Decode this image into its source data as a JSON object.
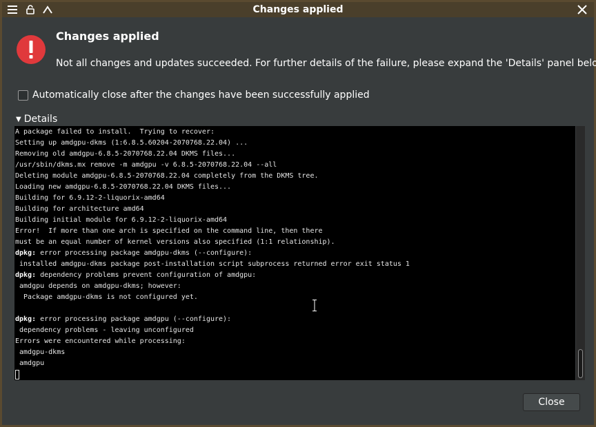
{
  "window": {
    "title": "Changes applied",
    "menu_icon": "hamburger-menu-icon",
    "unlock_icon": "unlock-icon",
    "up_icon": "chevron-up-icon",
    "close_icon": "close-icon"
  },
  "dialog": {
    "heading": "Changes applied",
    "message": "Not all changes and updates succeeded. For further details of the failure, please expand the 'Details' panel below.",
    "icon": "error-icon",
    "auto_close_label": "Automatically close after the changes have been successfully applied",
    "auto_close_checked": false,
    "details_label": "Details",
    "close_label": "Close"
  },
  "terminal": {
    "lines": [
      {
        "prefix": "",
        "text": "A package failed to install.  Trying to recover:"
      },
      {
        "prefix": "",
        "text": "Setting up amdgpu-dkms (1:6.8.5.60204-2070768.22.04) ..."
      },
      {
        "prefix": "",
        "text": "Removing old amdgpu-6.8.5-2070768.22.04 DKMS files..."
      },
      {
        "prefix": "",
        "text": "/usr/sbin/dkms.mx remove -m amdgpu -v 6.8.5-2070768.22.04 --all"
      },
      {
        "prefix": "",
        "text": "Deleting module amdgpu-6.8.5-2070768.22.04 completely from the DKMS tree."
      },
      {
        "prefix": "",
        "text": "Loading new amdgpu-6.8.5-2070768.22.04 DKMS files..."
      },
      {
        "prefix": "",
        "text": "Building for 6.9.12-2-liquorix-amd64"
      },
      {
        "prefix": "",
        "text": "Building for architecture amd64"
      },
      {
        "prefix": "",
        "text": "Building initial module for 6.9.12-2-liquorix-amd64"
      },
      {
        "prefix": "",
        "text": "Error!  If more than one arch is specified on the command line, then there"
      },
      {
        "prefix": "",
        "text": "must be an equal number of kernel versions also specified (1:1 relationship)."
      },
      {
        "prefix": "dpkg:",
        "text": " error processing package amdgpu-dkms (--configure):"
      },
      {
        "prefix": "",
        "text": " installed amdgpu-dkms package post-installation script subprocess returned error exit status 1"
      },
      {
        "prefix": "dpkg:",
        "text": " dependency problems prevent configuration of amdgpu:"
      },
      {
        "prefix": "",
        "text": " amdgpu depends on amdgpu-dkms; however:"
      },
      {
        "prefix": "",
        "text": "  Package amdgpu-dkms is not configured yet."
      },
      {
        "prefix": "",
        "text": ""
      },
      {
        "prefix": "dpkg:",
        "text": " error processing package amdgpu (--configure):"
      },
      {
        "prefix": "",
        "text": " dependency problems - leaving unconfigured"
      },
      {
        "prefix": "",
        "text": "Errors were encountered while processing:"
      },
      {
        "prefix": "",
        "text": " amdgpu-dkms"
      },
      {
        "prefix": "",
        "text": " amdgpu"
      }
    ]
  },
  "colors": {
    "error_red": "#e0393c",
    "background": "#383c3d",
    "terminal_bg": "#000000"
  }
}
